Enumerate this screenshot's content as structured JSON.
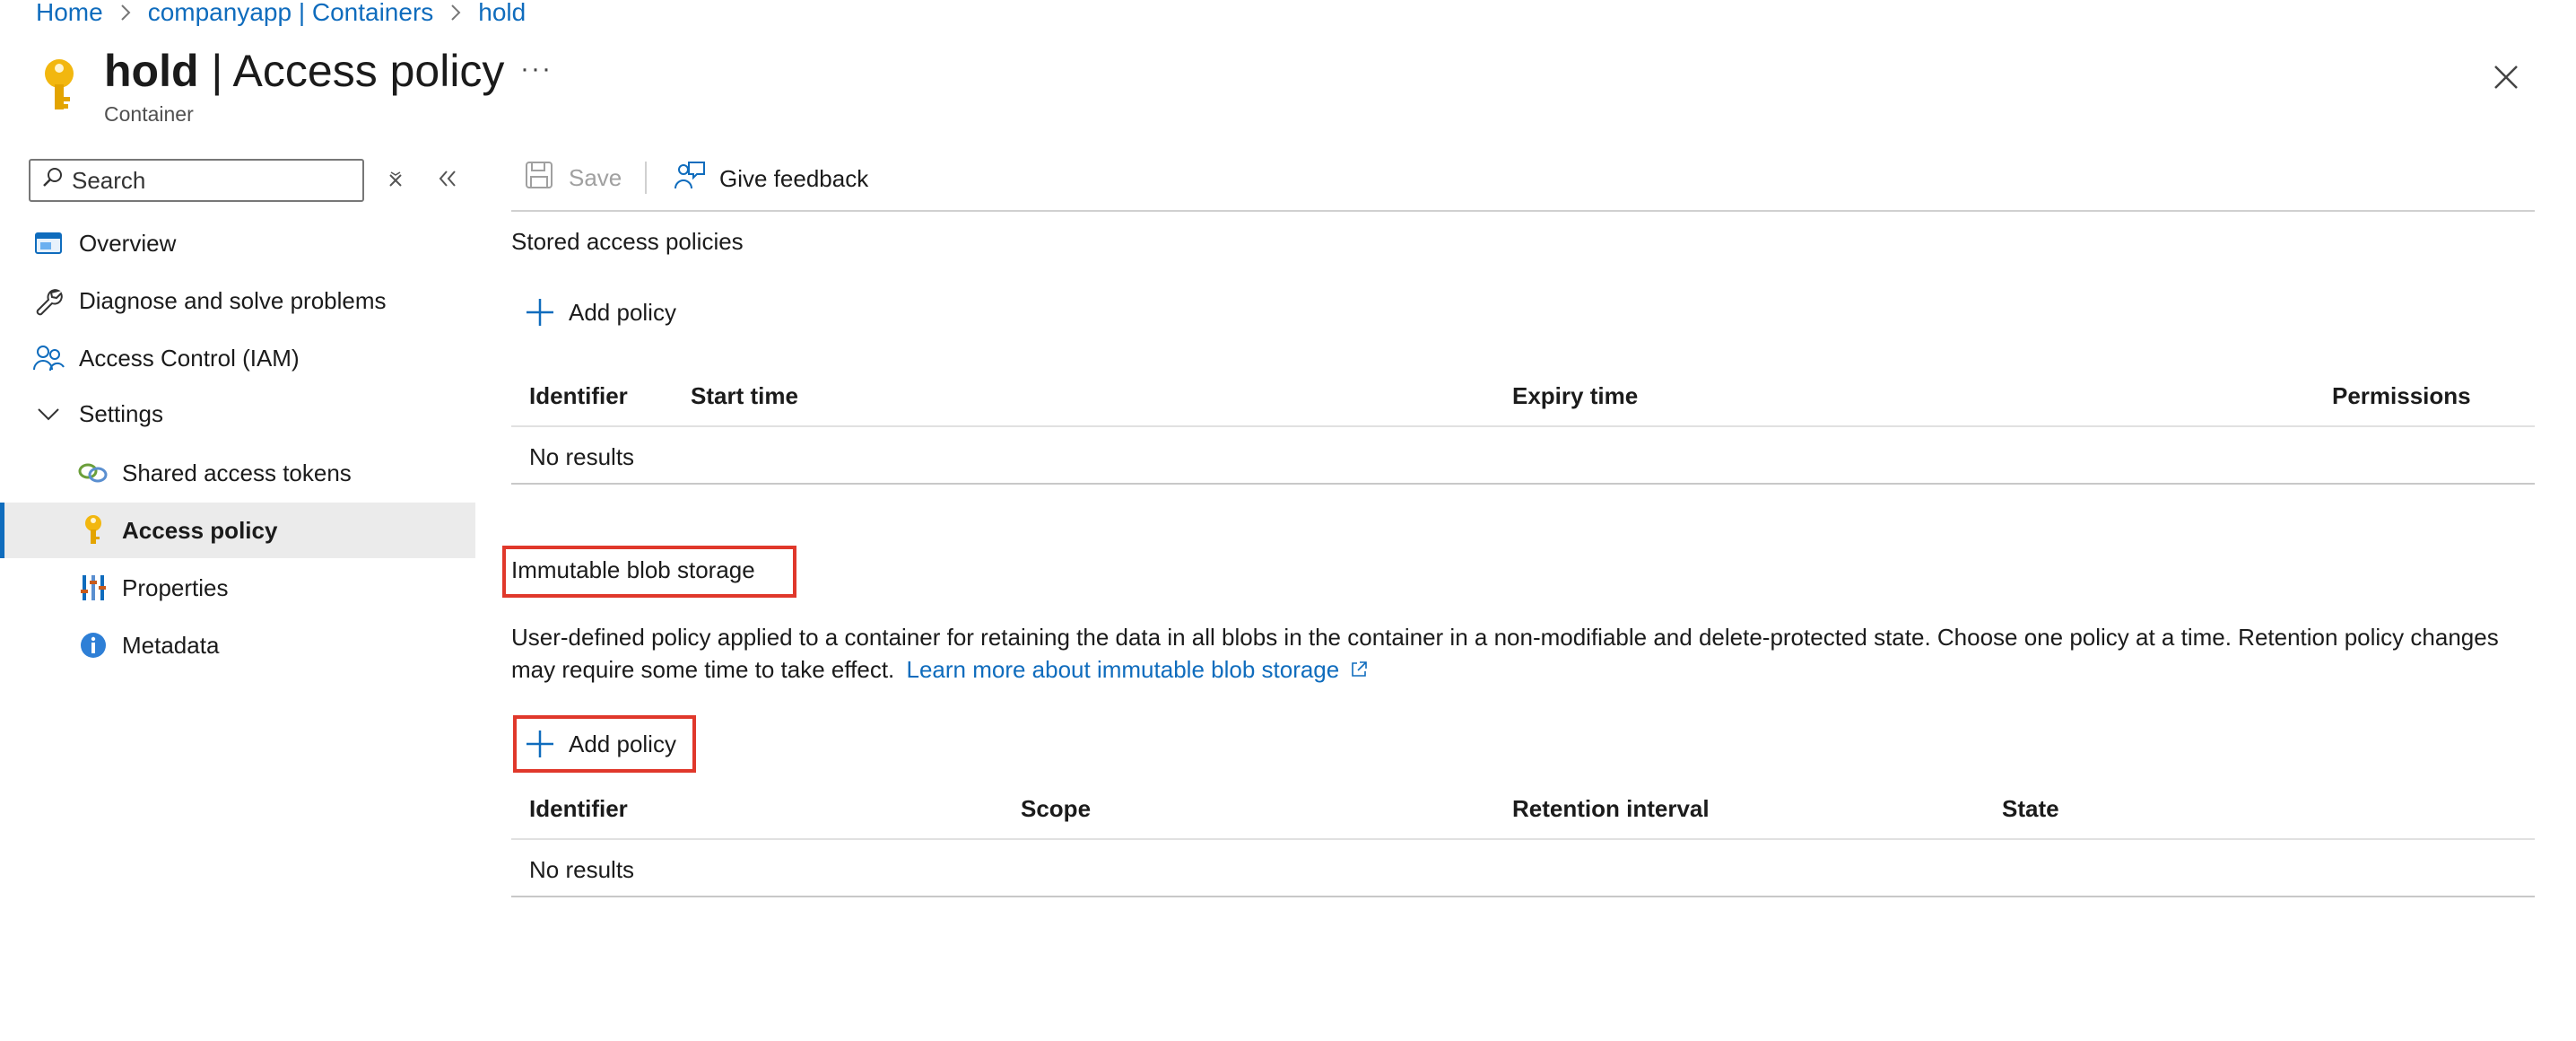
{
  "breadcrumb": [
    {
      "label": "Home"
    },
    {
      "label": "companyapp | Containers"
    },
    {
      "label": "hold"
    }
  ],
  "header": {
    "title_bold": "hold",
    "title_rest": " | Access policy",
    "subtitle": "Container",
    "more_label": "···"
  },
  "sidebar": {
    "search_placeholder": "Search",
    "items": [
      {
        "label": "Overview",
        "icon": "overview-icon"
      },
      {
        "label": "Diagnose and solve problems",
        "icon": "wrench-icon"
      },
      {
        "label": "Access Control (IAM)",
        "icon": "people-icon"
      },
      {
        "label": "Settings",
        "icon": "chevron-down-icon"
      },
      {
        "label": "Shared access tokens",
        "icon": "link-icon"
      },
      {
        "label": "Access policy",
        "icon": "key-icon",
        "selected": true
      },
      {
        "label": "Properties",
        "icon": "properties-icon"
      },
      {
        "label": "Metadata",
        "icon": "info-icon"
      }
    ]
  },
  "toolbar": {
    "save_label": "Save",
    "feedback_label": "Give feedback"
  },
  "stored": {
    "title": "Stored access policies",
    "add_label": "Add policy",
    "columns": [
      "Identifier",
      "Start time",
      "Expiry time",
      "Permissions"
    ],
    "empty": "No results"
  },
  "immutable": {
    "title": "Immutable blob storage",
    "description": "User-defined policy applied to a container for retaining the data in all blobs in the container in a non-modifiable and delete-protected state. Choose one policy at a time. Retention policy changes may require some time to take effect.",
    "learn_more": "Learn more about immutable blob storage",
    "add_label": "Add policy",
    "columns": [
      "Identifier",
      "Scope",
      "Retention interval",
      "State"
    ],
    "empty": "No results"
  },
  "colors": {
    "accent": "#0f6cbd",
    "highlight": "#e0382b",
    "key": "#f2b70f",
    "selected_bg": "#ebebeb"
  }
}
